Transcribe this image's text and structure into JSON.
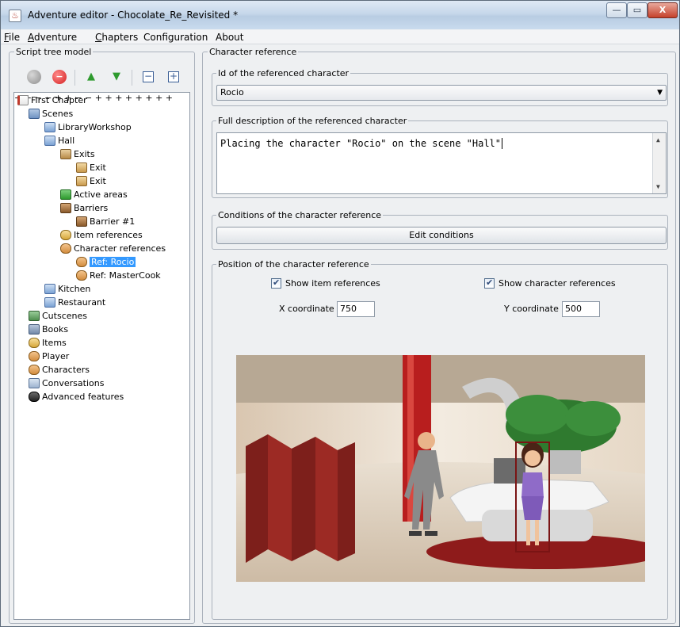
{
  "window": {
    "title": "Adventure editor - Chocolate_Re_Revisited *",
    "min_symbol": "—",
    "max_symbol": "▭",
    "close_symbol": "X"
  },
  "menu": {
    "items": [
      {
        "mnemonic": "F",
        "rest": "ile"
      },
      {
        "mnemonic": "A",
        "rest": "dventure"
      },
      {
        "mnemonic": "C",
        "rest": "hapters"
      },
      {
        "mnemonic": "",
        "rest": "Configuration"
      },
      {
        "mnemonic": "",
        "rest": "About"
      }
    ]
  },
  "script_tree": {
    "legend": "Script tree model",
    "toolbar": {
      "move_up": "▲",
      "move_down": "▼",
      "collapse": "−",
      "expand": "+"
    },
    "nodes": {
      "first_chapter": "First Chapter",
      "scenes": "Scenes",
      "library_workshop": "LibraryWorkshop",
      "hall": "Hall",
      "exits": "Exits",
      "exit_1": "Exit",
      "exit_2": "Exit",
      "active_areas": "Active areas",
      "barriers": "Barriers",
      "barrier_1": "Barrier #1",
      "item_references": "Item references",
      "character_references": "Character references",
      "ref_rocio": "Ref: Rocio",
      "ref_mastercook": "Ref: MasterCook",
      "kitchen": "Kitchen",
      "restaurant": "Restaurant",
      "cutscenes": "Cutscenes",
      "books": "Books",
      "items": "Items",
      "player": "Player",
      "characters": "Characters",
      "conversations": "Conversations",
      "advanced_features": "Advanced features"
    },
    "expander_collapsed": "+",
    "expander_expanded": "−"
  },
  "character_reference": {
    "legend": "Character reference",
    "id_group": {
      "legend": "Id of the referenced character",
      "selected": "Rocio",
      "arrow": "▼"
    },
    "description_group": {
      "legend": "Full description of the referenced character",
      "value": "Placing the character \"Rocio\" on the scene \"Hall\"",
      "scroll_up": "▲",
      "scroll_down": "▼"
    },
    "conditions_group": {
      "legend": "Conditions of the character reference",
      "button": "Edit conditions"
    },
    "position_group": {
      "legend": "Position of the character reference",
      "show_items_label": "Show item references",
      "show_items_checked": true,
      "show_characters_label": "Show character references",
      "show_characters_checked": true,
      "x_label": "X coordinate",
      "x_value": "750",
      "y_label": "Y coordinate",
      "y_value": "500"
    }
  },
  "colors": {
    "selection": "#3399ff",
    "reference_box": "#7a1414",
    "column": "#b81e1e"
  }
}
